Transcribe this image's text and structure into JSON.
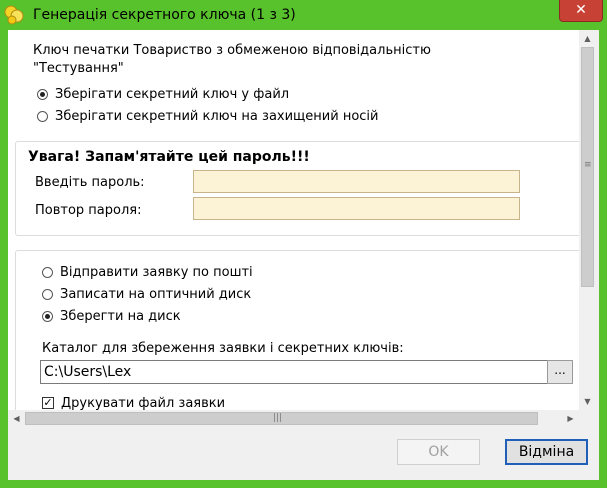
{
  "window": {
    "title": "Генерація секретного ключа (1 з 3)",
    "close_glyph": "✕",
    "title_bar_color": "#58c22c",
    "close_color": "#c74134"
  },
  "intro": {
    "line1": "Ключ печатки Товариство з обмеженою відповідальністю",
    "line2": "\"Тестування\""
  },
  "key_storage": {
    "options": [
      {
        "label": "Зберігати секретний ключ у файл",
        "selected": true
      },
      {
        "label": "Зберігати секретний ключ на захищений носій",
        "selected": false
      }
    ]
  },
  "password_panel": {
    "warning": "Увага! Запам'ятайте цей пароль!!!",
    "password_label": "Введіть пароль:",
    "password_value": "",
    "repeat_label": "Повтор пароля:",
    "repeat_value": ""
  },
  "request_panel": {
    "options": [
      {
        "label": "Відправити заявку  по пошті",
        "selected": false
      },
      {
        "label": "Записати на оптичний диск",
        "selected": false
      },
      {
        "label": "Зберегти на диск",
        "selected": true
      }
    ],
    "folder_label": "Каталог для збереження заявки і секретних ключів:",
    "folder_value": "C:\\Users\\Lex",
    "browse_label": "...",
    "print_label": "Друкувати файл заявки",
    "print_checked": true
  },
  "scrollbars": {
    "up_glyph": "▲",
    "down_glyph": "▼",
    "left_glyph": "◀",
    "right_glyph": "▶",
    "grip_v": "≡",
    "grip_h": "|||"
  },
  "buttons": {
    "ok_label": "OK",
    "cancel_label": "Відміна"
  },
  "colors": {
    "field_background": "#fcf2d6",
    "default_button_border": "#1f5fb8"
  }
}
